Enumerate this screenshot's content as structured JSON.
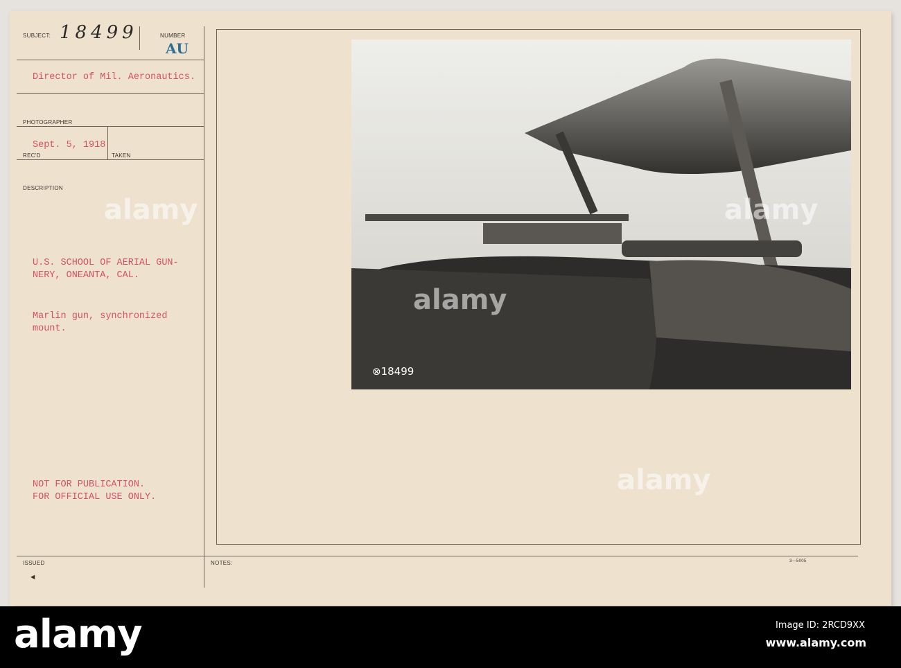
{
  "card": {
    "subject_label": "SUBJECT:",
    "subject_number": "18499",
    "number_label": "NUMBER",
    "number_stamp": "AU",
    "director": "Director of Mil. Aeronautics.",
    "photographer_label": "PHOTOGRAPHER",
    "date": "Sept. 5, 1918",
    "recd_label": "REC'D",
    "taken_label": "TAKEN",
    "description_label": "DESCRIPTION",
    "description_line1": "U.S. SCHOOL OF AERIAL GUN-",
    "description_line2": "NERY, ONEANTA, CAL.",
    "caption_line1": "Marlin gun, synchronized",
    "caption_line2": "mount.",
    "notice_line1": "NOT FOR PUBLICATION.",
    "notice_line2": "FOR OFFICIAL USE ONLY.",
    "issued_label": "ISSUED",
    "issued_mark": "◄",
    "notes_label": "NOTES:",
    "form_number": "3—5005",
    "photo_number": "⊗18499"
  },
  "watermark": "alamy",
  "footer": {
    "logo": "alamy",
    "image_id": "Image ID: 2RCD9XX",
    "url": "www.alamy.com"
  }
}
